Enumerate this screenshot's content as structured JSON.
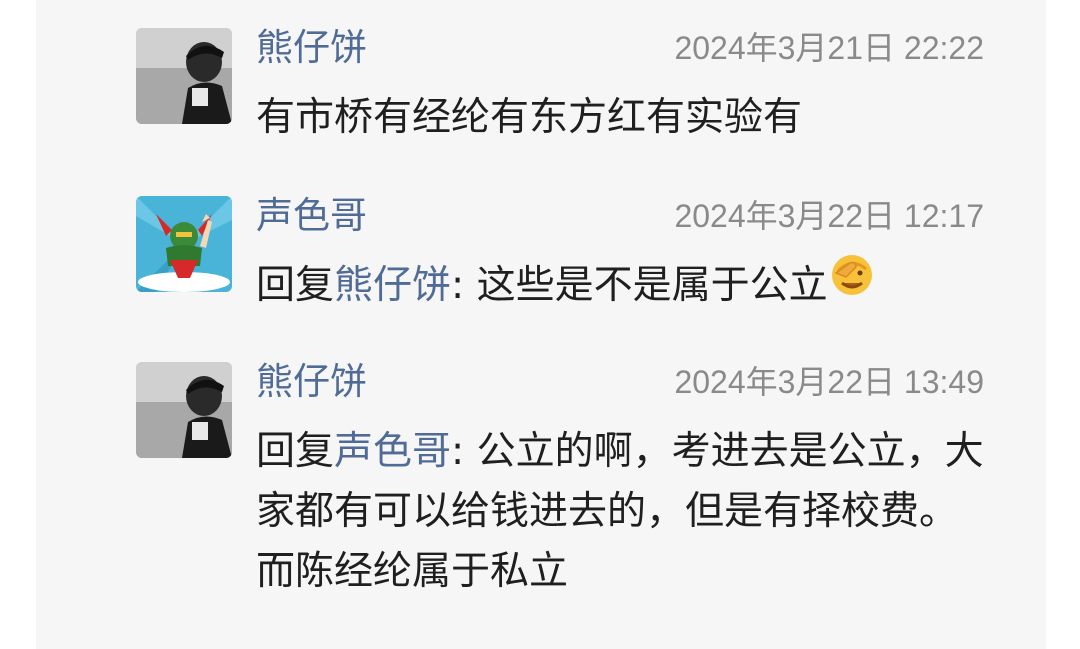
{
  "comments": [
    {
      "avatar": "avatar-person-bw",
      "name": "熊仔饼",
      "time": "2024年3月21日 22:22",
      "text": "有市桥有经纶有东方红有实验有"
    },
    {
      "avatar": "avatar-superhero-cartoon",
      "name": "声色哥",
      "time": "2024年3月22日 12:17",
      "reply_prefix": "回复",
      "reply_to": "熊仔饼",
      "text": ": 这些是不是属于公立",
      "emoji": "facepalm-emoji"
    },
    {
      "avatar": "avatar-person-bw",
      "name": "熊仔饼",
      "time": "2024年3月22日 13:49",
      "reply_prefix": "回复",
      "reply_to": "声色哥",
      "text": ": 公立的啊，考进去是公立，大家都有可以给钱进去的，但是有择校费。而陈经纶属于私立"
    }
  ],
  "colors": {
    "background": "#f6f6f6",
    "name": "#4f6b96",
    "time": "#8a8a8a",
    "text": "#1f1f1f"
  }
}
